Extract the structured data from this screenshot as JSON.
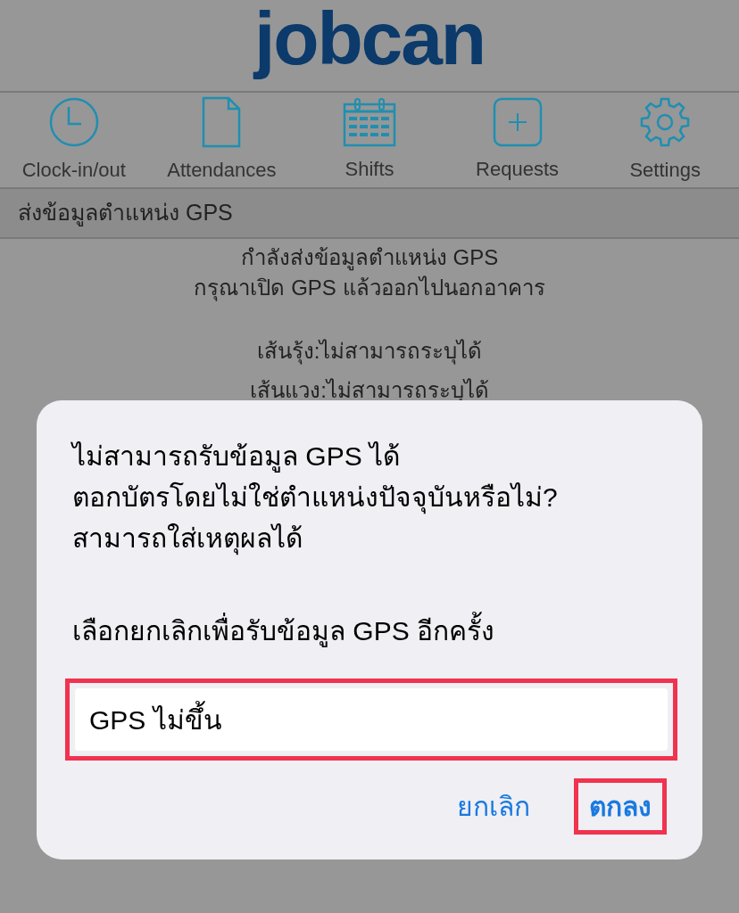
{
  "logo": "jobcan",
  "nav": [
    {
      "kind": "clock",
      "label": "Clock-in/out"
    },
    {
      "kind": "document",
      "label": "Attendances"
    },
    {
      "kind": "calendar",
      "label": "Shifts"
    },
    {
      "kind": "plus",
      "label": "Requests"
    },
    {
      "kind": "gear",
      "label": "Settings"
    }
  ],
  "section_title": "ส่งข้อมูลตำแหน่ง GPS",
  "status_lines": [
    "กำลังส่งข้อมูลตำแหน่ง GPS",
    "กรุณาเปิด GPS แล้วออกไปนอกอาคาร"
  ],
  "coords": [
    "เส้นรุ้ง:ไม่สามารถระบุได้",
    "เส้นแวง:ไม่สามารถระบุได้"
  ],
  "dialog": {
    "message": [
      "ไม่สามารถรับข้อมูล GPS ได้",
      "ตอกบัตรโดยไม่ใช่ตำแหน่งปัจจุบันหรือไม่?",
      "สามารถใส่เหตุผลได้"
    ],
    "hint": "เลือกยกเลิกเพื่อรับข้อมูล GPS อีกครั้ง",
    "field": {
      "value": "GPS ไม่ขึ้น",
      "highlighted": true
    },
    "buttons": [
      {
        "label": "ยกเลิก",
        "highlighted": false
      },
      {
        "label": "ตกลง",
        "highlighted": true
      }
    ]
  }
}
